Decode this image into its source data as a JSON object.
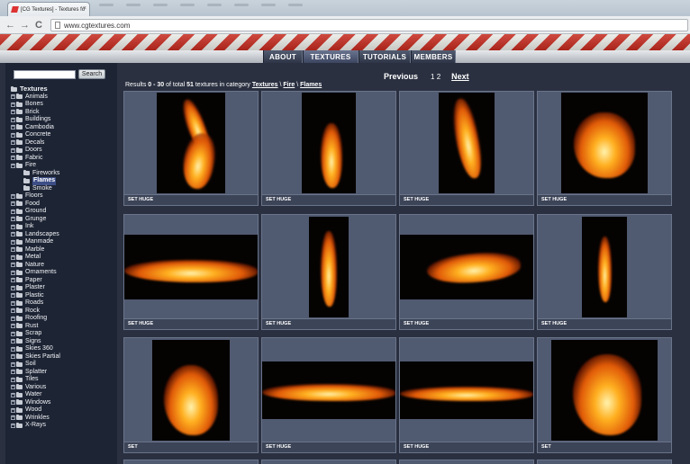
{
  "browser": {
    "tab_title": "[CG Textures] - Textures fo",
    "tab_close": "×",
    "back": "←",
    "forward": "→",
    "reload": "C",
    "url": "www.cgtextures.com"
  },
  "nav": {
    "items": [
      {
        "label": "ABOUT",
        "active": false
      },
      {
        "label": "TEXTURES",
        "active": true
      },
      {
        "label": "TUTORIALS",
        "active": false
      },
      {
        "label": "MEMBERS",
        "active": false
      }
    ]
  },
  "sidebar": {
    "search_placeholder": "",
    "search_button": "Search",
    "root": "Textures",
    "categories": [
      "Animals",
      "Bones",
      "Brick",
      "Buildings",
      "Cambodia",
      "Concrete",
      "Decals",
      "Doors",
      "Fabric",
      "Fire",
      "Floors",
      "Food",
      "Ground",
      "Grunge",
      "Ink",
      "Landscapes",
      "Manmade",
      "Marble",
      "Metal",
      "Nature",
      "Ornaments",
      "Paper",
      "Plaster",
      "Plastic",
      "Roads",
      "Rock",
      "Roofing",
      "Rust",
      "Scrap",
      "Signs",
      "Skies 360",
      "Skies Partial",
      "Soil",
      "Splatter",
      "Tiles",
      "Various",
      "Water",
      "Windows",
      "Wood",
      "Wrinkles",
      "X-Rays"
    ],
    "fire_children": [
      "Fireworks",
      "Flames",
      "Smoke"
    ],
    "selected": "Flames"
  },
  "main": {
    "pager": {
      "previous": "Previous",
      "pages": "1 2",
      "next": "Next"
    },
    "results": {
      "prefix": "Results ",
      "range": "0 - 30",
      "middle": " of total ",
      "total": "51",
      "suffix": " textures in category ",
      "path": [
        "Textures",
        "Fire",
        "Flames"
      ],
      "sep": " \\ "
    },
    "cards": [
      {
        "label": "SET HUGE"
      },
      {
        "label": "SET HUGE"
      },
      {
        "label": "SET HUGE"
      },
      {
        "label": "SET HUGE"
      },
      {
        "label": "SET HUGE"
      },
      {
        "label": "SET HUGE"
      },
      {
        "label": "SET HUGE"
      },
      {
        "label": "SET HUGE"
      },
      {
        "label": "SET"
      },
      {
        "label": "SET HUGE"
      },
      {
        "label": "SET HUGE"
      },
      {
        "label": "SET"
      }
    ]
  }
}
